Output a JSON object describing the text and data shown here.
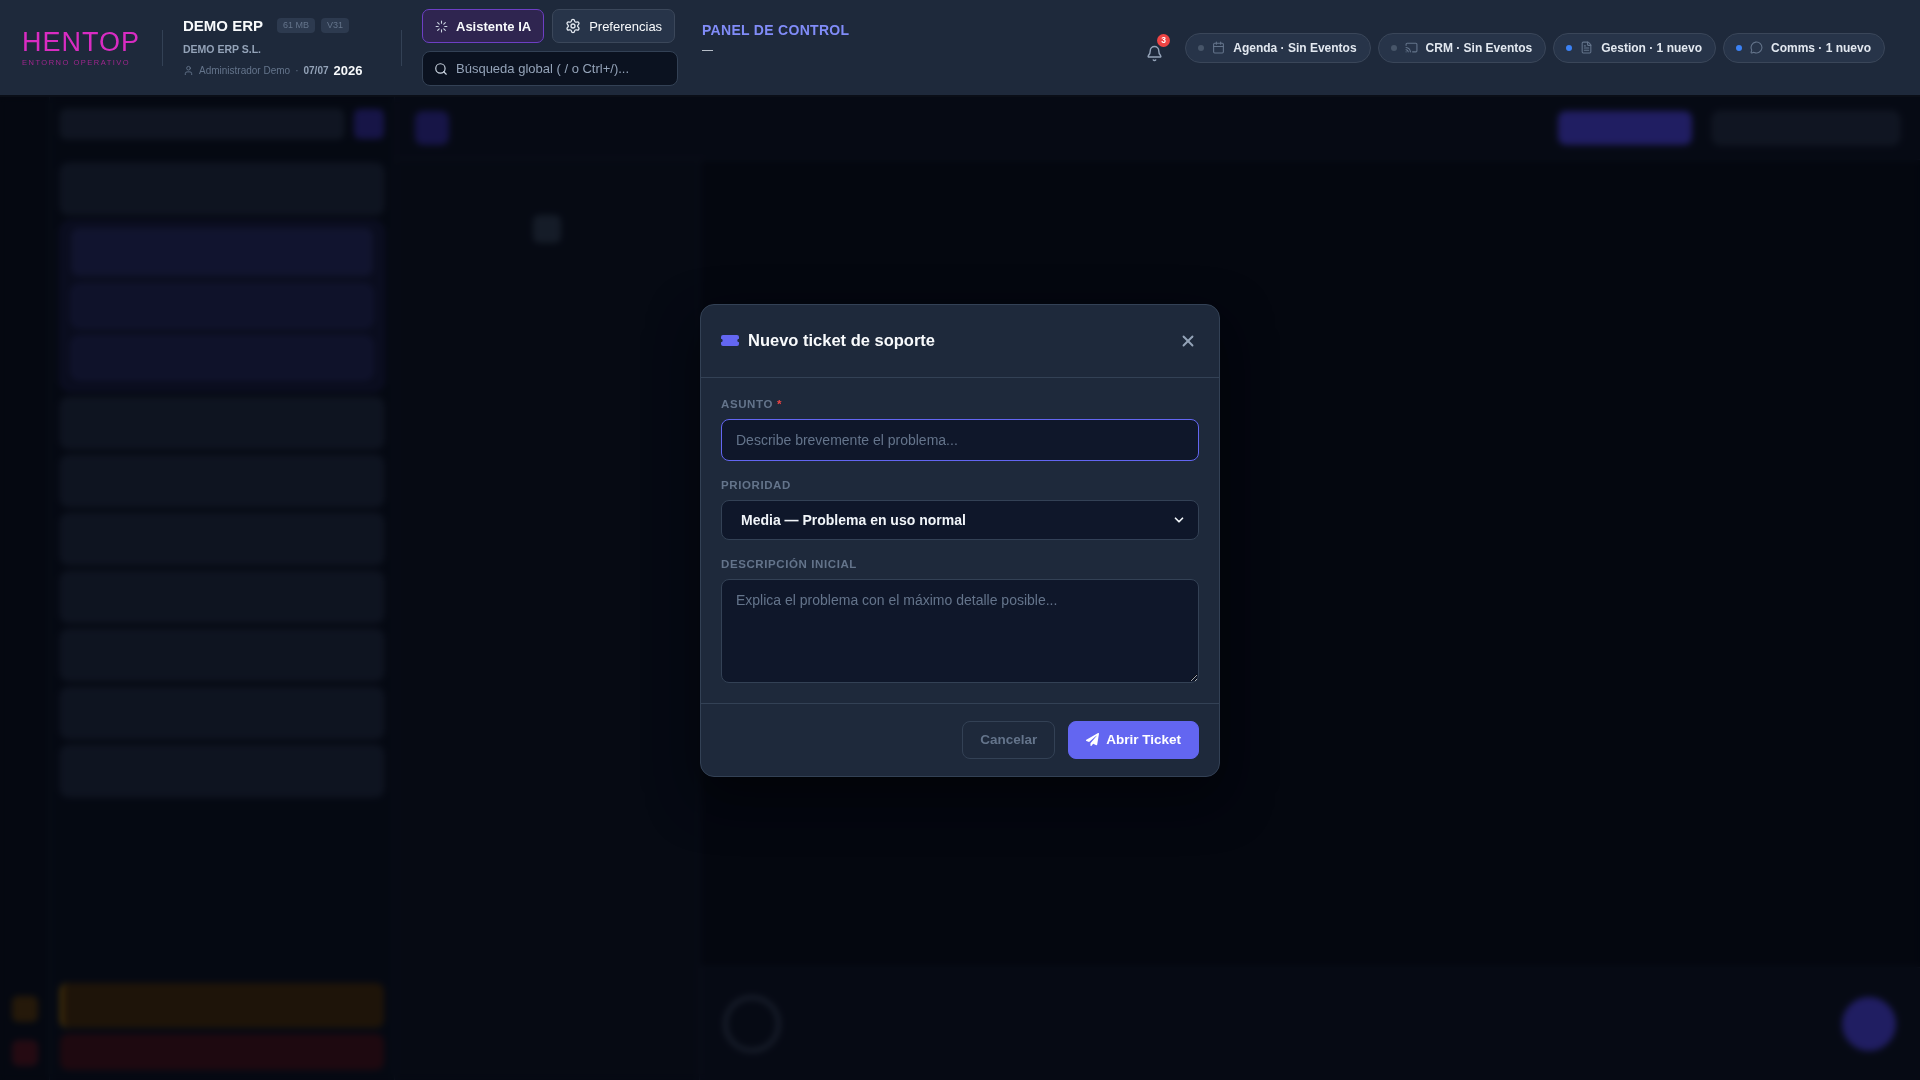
{
  "header": {
    "logo": {
      "wordmark": "HENTOP",
      "tagline": "ENTORNO OPERATIVO"
    },
    "company": {
      "name": "DEMO ERP",
      "badges": [
        "61 MB",
        "V31"
      ],
      "legal_name": "DEMO ERP S.L.",
      "user": "Administrador Demo",
      "separator": "·",
      "date": "07/07",
      "year": "2026"
    },
    "actions": [
      {
        "kind": "assistant",
        "label": "Asistente IA"
      },
      {
        "kind": "settings",
        "label": "Preferencias"
      }
    ],
    "search": {
      "placeholder": "Búsqueda global ( / o Ctrl+/)..."
    },
    "section": {
      "title": "PANEL DE CONTROL",
      "subtitle": "—"
    },
    "notifications": {
      "count": "3"
    },
    "status_pills": [
      {
        "kind": "calendar",
        "label": "Agenda · Sin Eventos",
        "color": "#475569"
      },
      {
        "kind": "screen",
        "label": "CRM · Sin Eventos",
        "color": "#475569"
      },
      {
        "kind": "document",
        "label": "Gestion · 1 nuevo",
        "color": "#3b82f6"
      },
      {
        "kind": "chat",
        "label": "Comms · 1 nuevo",
        "color": "#3b82f6"
      }
    ]
  },
  "modal": {
    "title": "Nuevo ticket de soporte",
    "fields": [
      {
        "kind": "text",
        "label": "ASUNTO",
        "required_mark": "*",
        "placeholder": "Describe brevemente el problema...",
        "focused": true
      },
      {
        "kind": "select",
        "label": "PRIORIDAD",
        "value": "Media — Problema en uso normal",
        "focused": false
      },
      {
        "kind": "textarea",
        "label": "DESCRIPCIÓN INICIAL",
        "placeholder": "Explica el problema con el máximo detalle posible...",
        "focused": false
      }
    ],
    "buttons": [
      {
        "kind": "secondary",
        "label": "Cancelar"
      },
      {
        "kind": "primary",
        "label": "Abrir Ticket"
      }
    ]
  }
}
